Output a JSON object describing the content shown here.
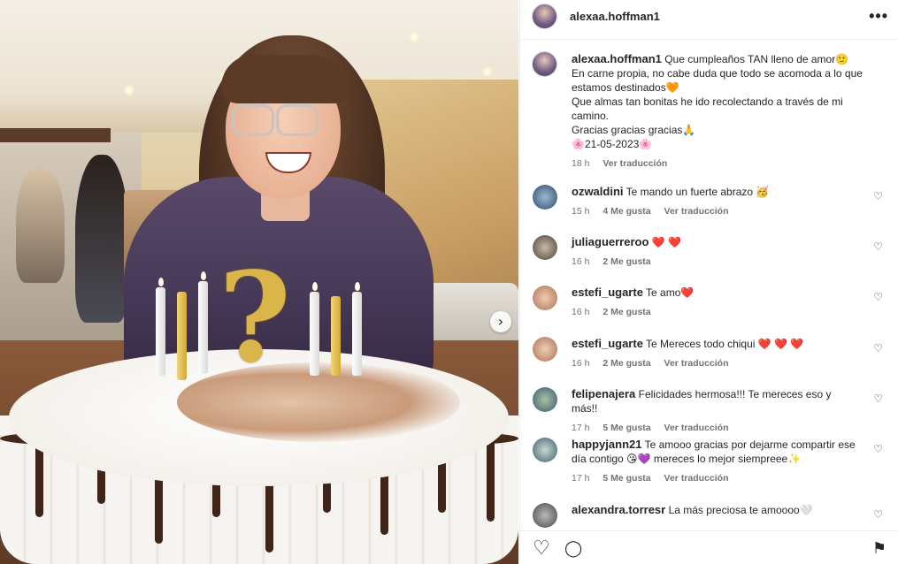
{
  "post": {
    "username": "alexaa.hoffman1",
    "more_label": "•••",
    "carousel_next": "›",
    "caption_lines": [
      "Que cumpleaños TAN lleno de amor🙂",
      "En carne propia, no cabe duda que todo se acomoda a lo que",
      "estamos destinados🧡",
      "Que almas tan bonitas he ido recolectando a través de mi",
      "camino.",
      "Gracias gracias gracias🙏",
      "🌸21-05-2023🌸"
    ],
    "caption_time": "18 h",
    "caption_translate": "Ver traducción"
  },
  "comments": [
    {
      "user": "ozwaldini",
      "text": "Te mando un fuerte abrazo 🥳",
      "time": "15 h",
      "likes": "4 Me gusta",
      "translate": "Ver traducción"
    },
    {
      "user": "juliaguerreroo",
      "text": "❤️ ❤️",
      "time": "16 h",
      "likes": "2 Me gusta",
      "translate": ""
    },
    {
      "user": "estefi_ugarte",
      "text": "Te amo❤️",
      "time": "16 h",
      "likes": "2 Me gusta",
      "translate": ""
    },
    {
      "user": "estefi_ugarte",
      "text": "Te Mereces todo chiqui ❤️ ❤️ ❤️",
      "time": "16 h",
      "likes": "2 Me gusta",
      "translate": "Ver traducción"
    },
    {
      "user": "felipenajera",
      "text": "Felicidades hermosa!!! Te mereces eso y más!!",
      "time": "17 h",
      "likes": "5 Me gusta",
      "translate": "Ver traducción"
    },
    {
      "user": "happyjann21",
      "text": "Te amooo gracias por dejarme compartir ese día contigo 😘💜 mereces lo mejor siempreee✨",
      "time": "17 h",
      "likes": "5 Me gusta",
      "translate": "Ver traducción"
    },
    {
      "user": "alexandra.torresr",
      "text": "La más preciosa te amoooo🤍",
      "time": "",
      "likes": "",
      "translate": ""
    }
  ],
  "icons": {
    "like": "♡",
    "comment": "◯",
    "save": "⚑",
    "comment_like": "♡"
  },
  "colors": {
    "text": "#262626",
    "secondary": "#737373",
    "divider": "#efefef"
  }
}
